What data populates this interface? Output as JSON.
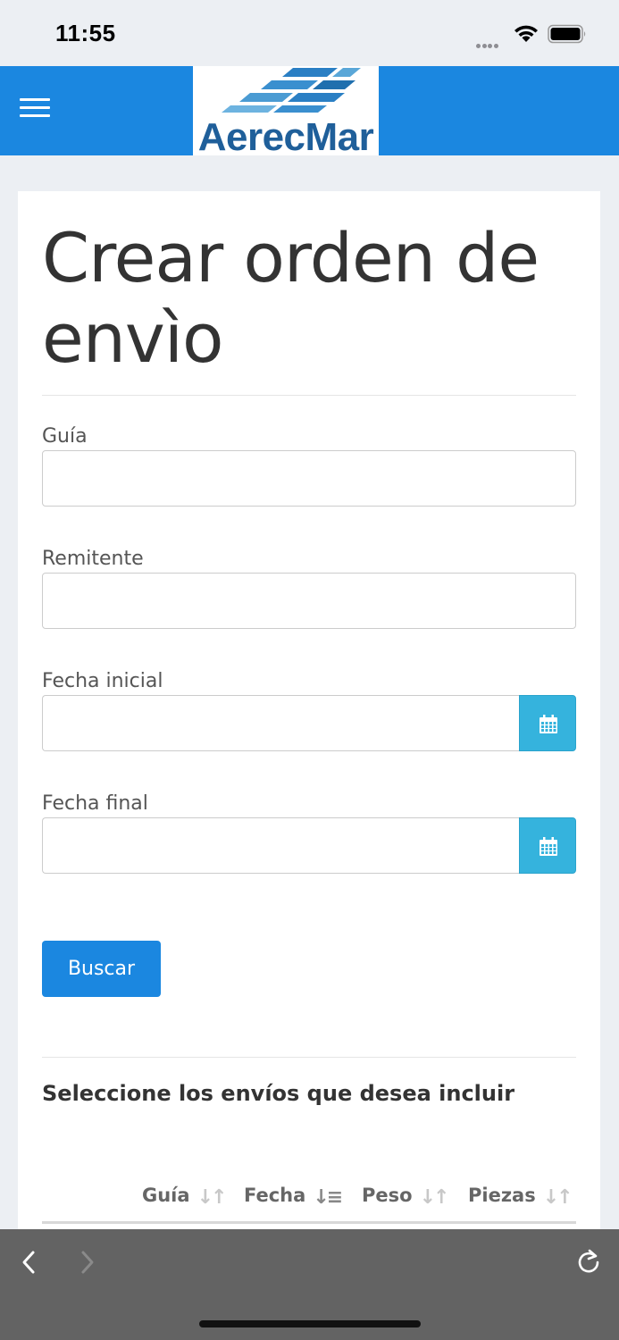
{
  "status_bar": {
    "time": "11:55"
  },
  "header": {
    "menu_icon": "hamburger-icon",
    "logo_text": "AerecMar",
    "brand_color": "#1b87e0"
  },
  "form": {
    "title": "Crear orden de envìo",
    "fields": {
      "guia": {
        "label": "Guía",
        "value": ""
      },
      "remitente": {
        "label": "Remitente",
        "value": ""
      },
      "fecha_inicial": {
        "label": "Fecha inicial",
        "value": "",
        "icon": "calendar-icon"
      },
      "fecha_final": {
        "label": "Fecha final",
        "value": "",
        "icon": "calendar-icon"
      }
    },
    "search_label": "Buscar"
  },
  "shipments": {
    "heading": "Seleccione los envíos que desea incluir",
    "columns": [
      "Guía",
      "Fecha",
      "Peso",
      "Piezas"
    ],
    "sorted_column": "Fecha"
  },
  "browser_bar": {
    "back_icon": "chevron-left-icon",
    "forward_icon": "chevron-right-icon",
    "reload_icon": "reload-icon"
  }
}
